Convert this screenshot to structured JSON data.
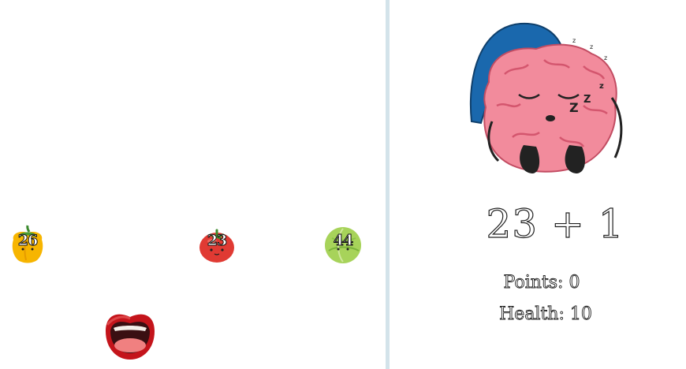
{
  "game": {
    "equation": "23 + 1",
    "points_text": "Points: 0",
    "health_text": "Health: 10"
  },
  "vegetables": [
    {
      "name": "yellow-pepper",
      "number": "26",
      "color": "#f5b400"
    },
    {
      "name": "tomato",
      "number": "23",
      "color": "#e0342f"
    },
    {
      "name": "cabbage",
      "number": "44",
      "color": "#a9d35a"
    }
  ],
  "icons": {
    "player": "open-mouth-icon",
    "character": "sleeping-brain-icon"
  },
  "colors": {
    "divider": "#d3e3ea",
    "nightcap": "#1a68ad",
    "brain": "#f28b9c"
  }
}
